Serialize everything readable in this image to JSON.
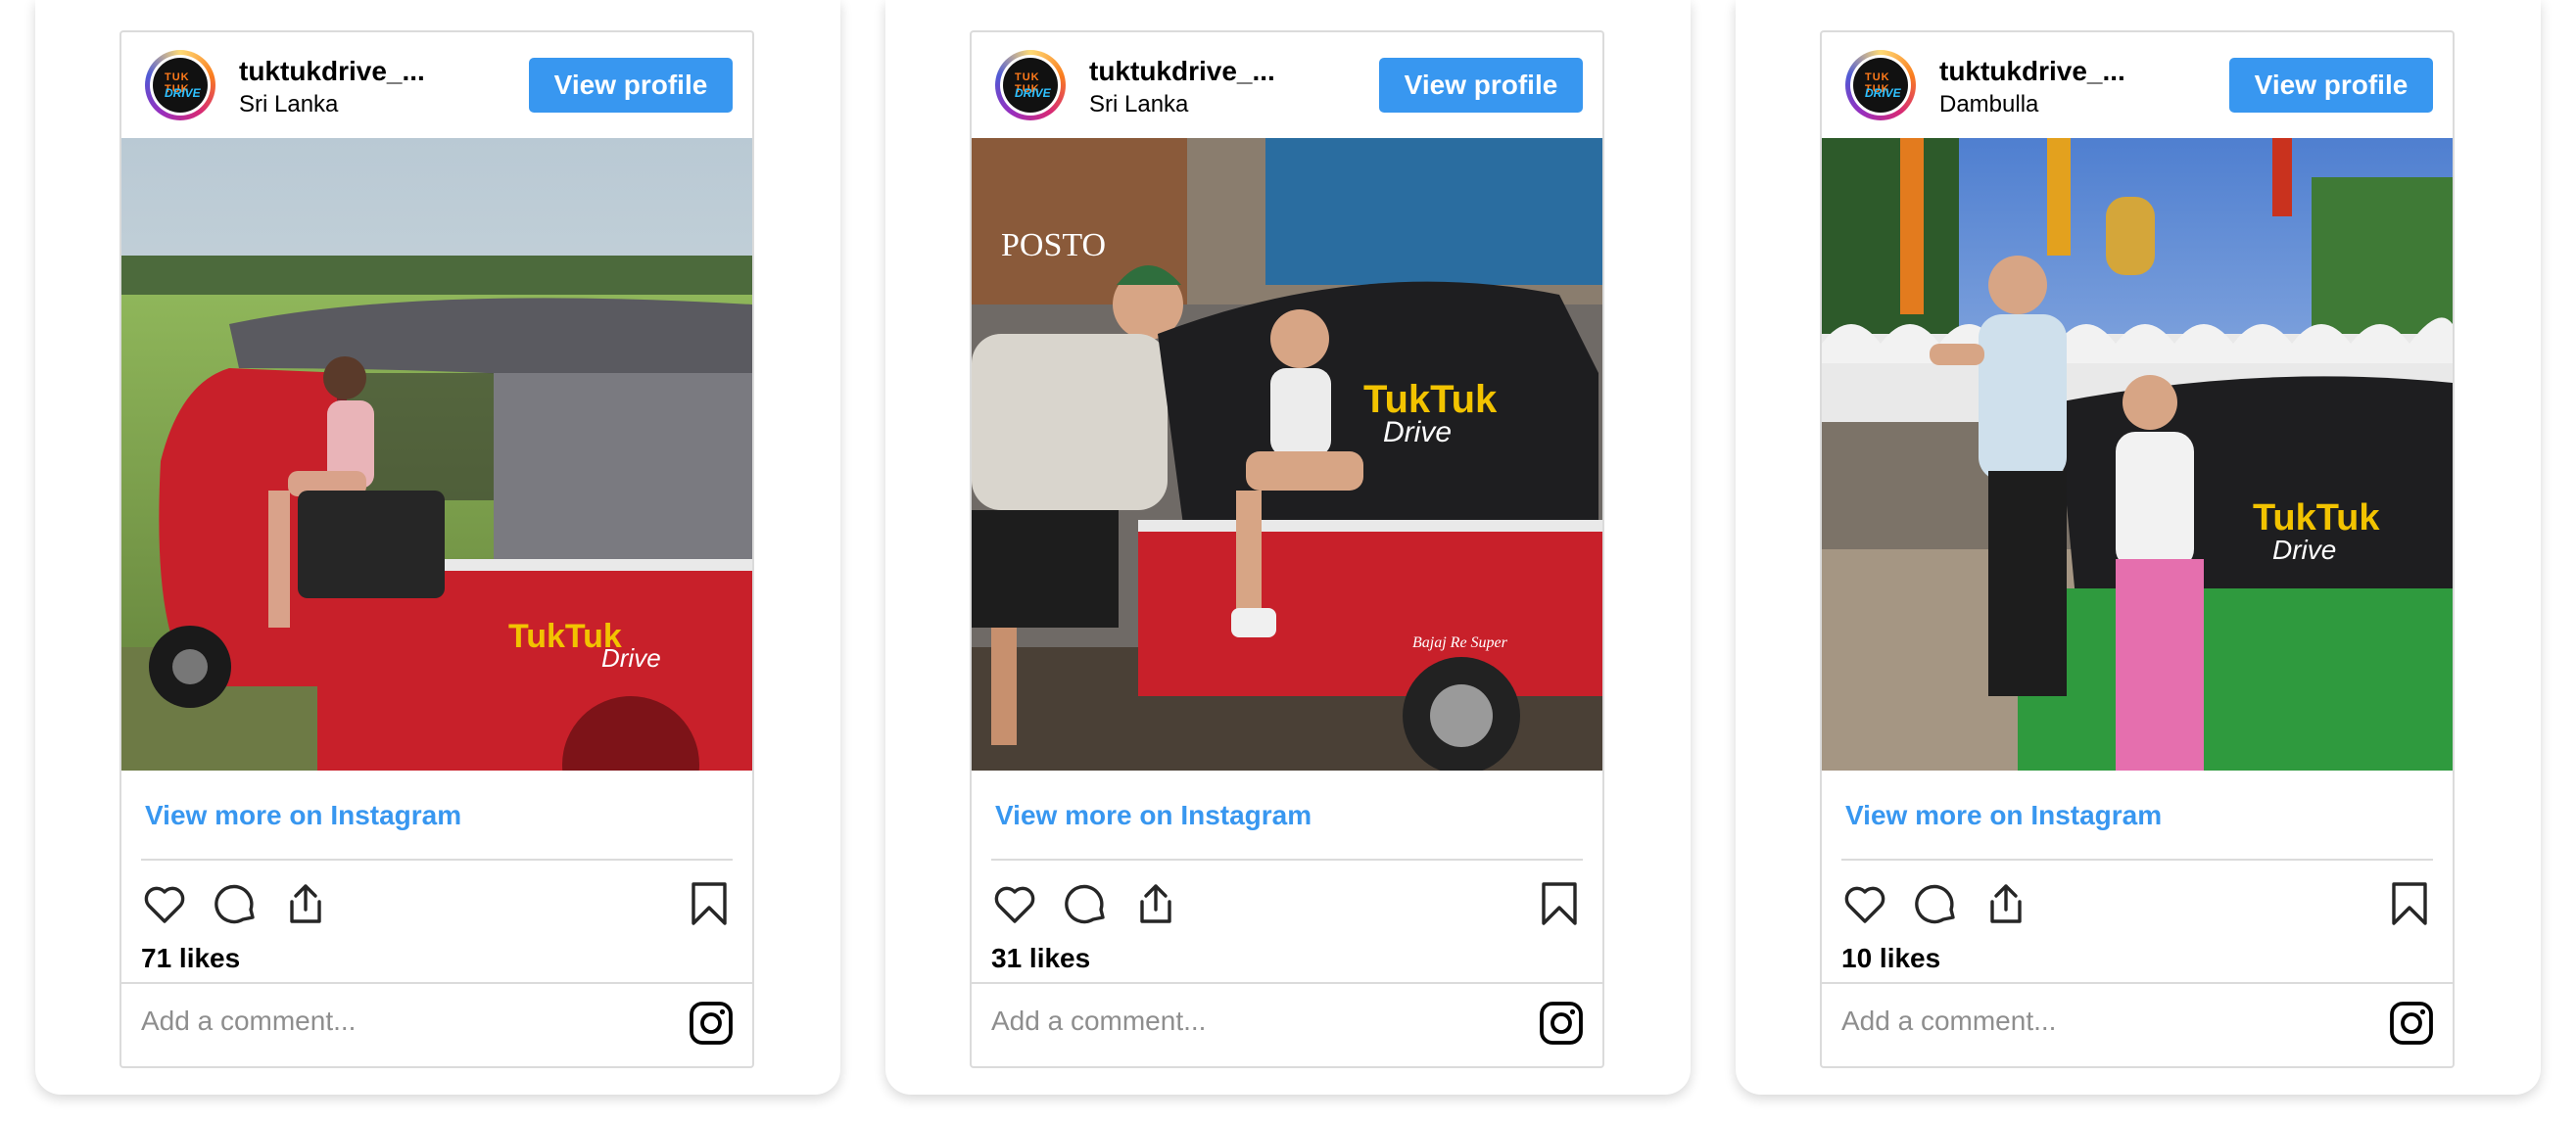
{
  "posts": [
    {
      "username": "tuktukdrive_...",
      "location": "Sri Lanka",
      "view_profile_label": "View profile",
      "photo_description": "Woman driving a red tuk-tuk with grey roof in a rice field",
      "view_more_label": "View more on Instagram",
      "likes": "71 likes",
      "comment_placeholder": "Add a comment...",
      "avatar_logo_top": "TUK TUK",
      "avatar_logo_bottom": "DRIVE"
    },
    {
      "username": "tuktukdrive_...",
      "location": "Sri Lanka",
      "view_profile_label": "View profile",
      "photo_description": "Two travelers posing with a red and black tuk-tuk near Posto restaurant",
      "view_more_label": "View more on Instagram",
      "likes": "31 likes",
      "comment_placeholder": "Add a comment...",
      "avatar_logo_top": "TUK TUK",
      "avatar_logo_bottom": "DRIVE"
    },
    {
      "username": "tuktukdrive_...",
      "location": "Dambulla",
      "view_profile_label": "View profile",
      "photo_description": "Couple giving thumbs up beside a green and black tuk-tuk at a temple with golden Buddha",
      "view_more_label": "View more on Instagram",
      "likes": "10 likes",
      "comment_placeholder": "Add a comment...",
      "avatar_logo_top": "TUK TUK",
      "avatar_logo_bottom": "DRIVE"
    }
  ],
  "photo_signage": {
    "tuktuk_brand_a": "TukTuk",
    "tuktuk_brand_b": "Drive",
    "restaurant_sign": "POSTO",
    "bajaj_label": "Bajaj Re Super"
  },
  "colors": {
    "accent_blue": "#3897f0",
    "border": "#dbdbdb",
    "placeholder_gray": "#8e8e8e",
    "tuktuk_red": "#c8202a",
    "tuktuk_green": "#2f9a3e"
  },
  "icons": [
    "heart-icon",
    "comment-icon",
    "share-icon",
    "bookmark-icon",
    "instagram-icon"
  ]
}
